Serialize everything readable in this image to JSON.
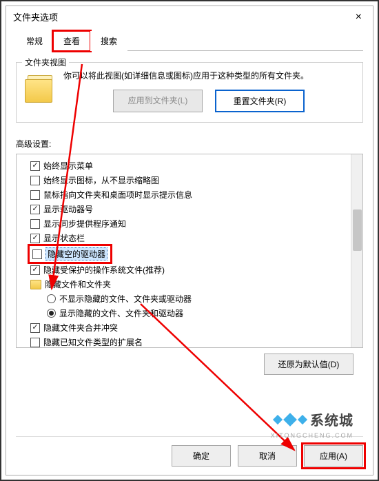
{
  "dialog": {
    "title": "文件夹选项",
    "close": "×"
  },
  "tabs": {
    "general": "常规",
    "view": "查看",
    "search": "搜索"
  },
  "folderView": {
    "groupTitle": "文件夹视图",
    "desc": "你可以将此视图(如详细信息或图标)应用于这种类型的所有文件夹。",
    "applyBtn": "应用到文件夹(L)",
    "resetBtn": "重置文件夹(R)"
  },
  "advanced": {
    "label": "高级设置:",
    "items": [
      {
        "chk": true,
        "label": "始终显示菜单"
      },
      {
        "chk": false,
        "label": "始终显示图标，从不显示缩略图"
      },
      {
        "chk": false,
        "label": "鼠标指向文件夹和桌面项时显示提示信息"
      },
      {
        "chk": true,
        "label": "显示驱动器号"
      },
      {
        "chk": false,
        "label": "显示同步提供程序通知"
      },
      {
        "chk": true,
        "label": "显示状态栏"
      },
      {
        "chk": false,
        "label": "隐藏空的驱动器",
        "highlighted": true,
        "selected": true
      },
      {
        "chk": true,
        "label": "隐藏受保护的操作系统文件(推荐)"
      },
      {
        "folder": true,
        "label": "隐藏文件和文件夹"
      },
      {
        "radio": false,
        "sub": true,
        "label": "不显示隐藏的文件、文件夹或驱动器"
      },
      {
        "radio": true,
        "sub": true,
        "label": "显示隐藏的文件、文件夹和驱动器"
      },
      {
        "chk": true,
        "label": "隐藏文件夹合并冲突"
      },
      {
        "chk": false,
        "label": "隐藏已知文件类型的扩展名"
      }
    ]
  },
  "restoreDefaults": "还原为默认值(D)",
  "buttons": {
    "ok": "确定",
    "cancel": "取消",
    "apply": "应用(A)"
  },
  "watermark": {
    "text": "系统城",
    "sub": "XITONGCHENG.COM"
  }
}
